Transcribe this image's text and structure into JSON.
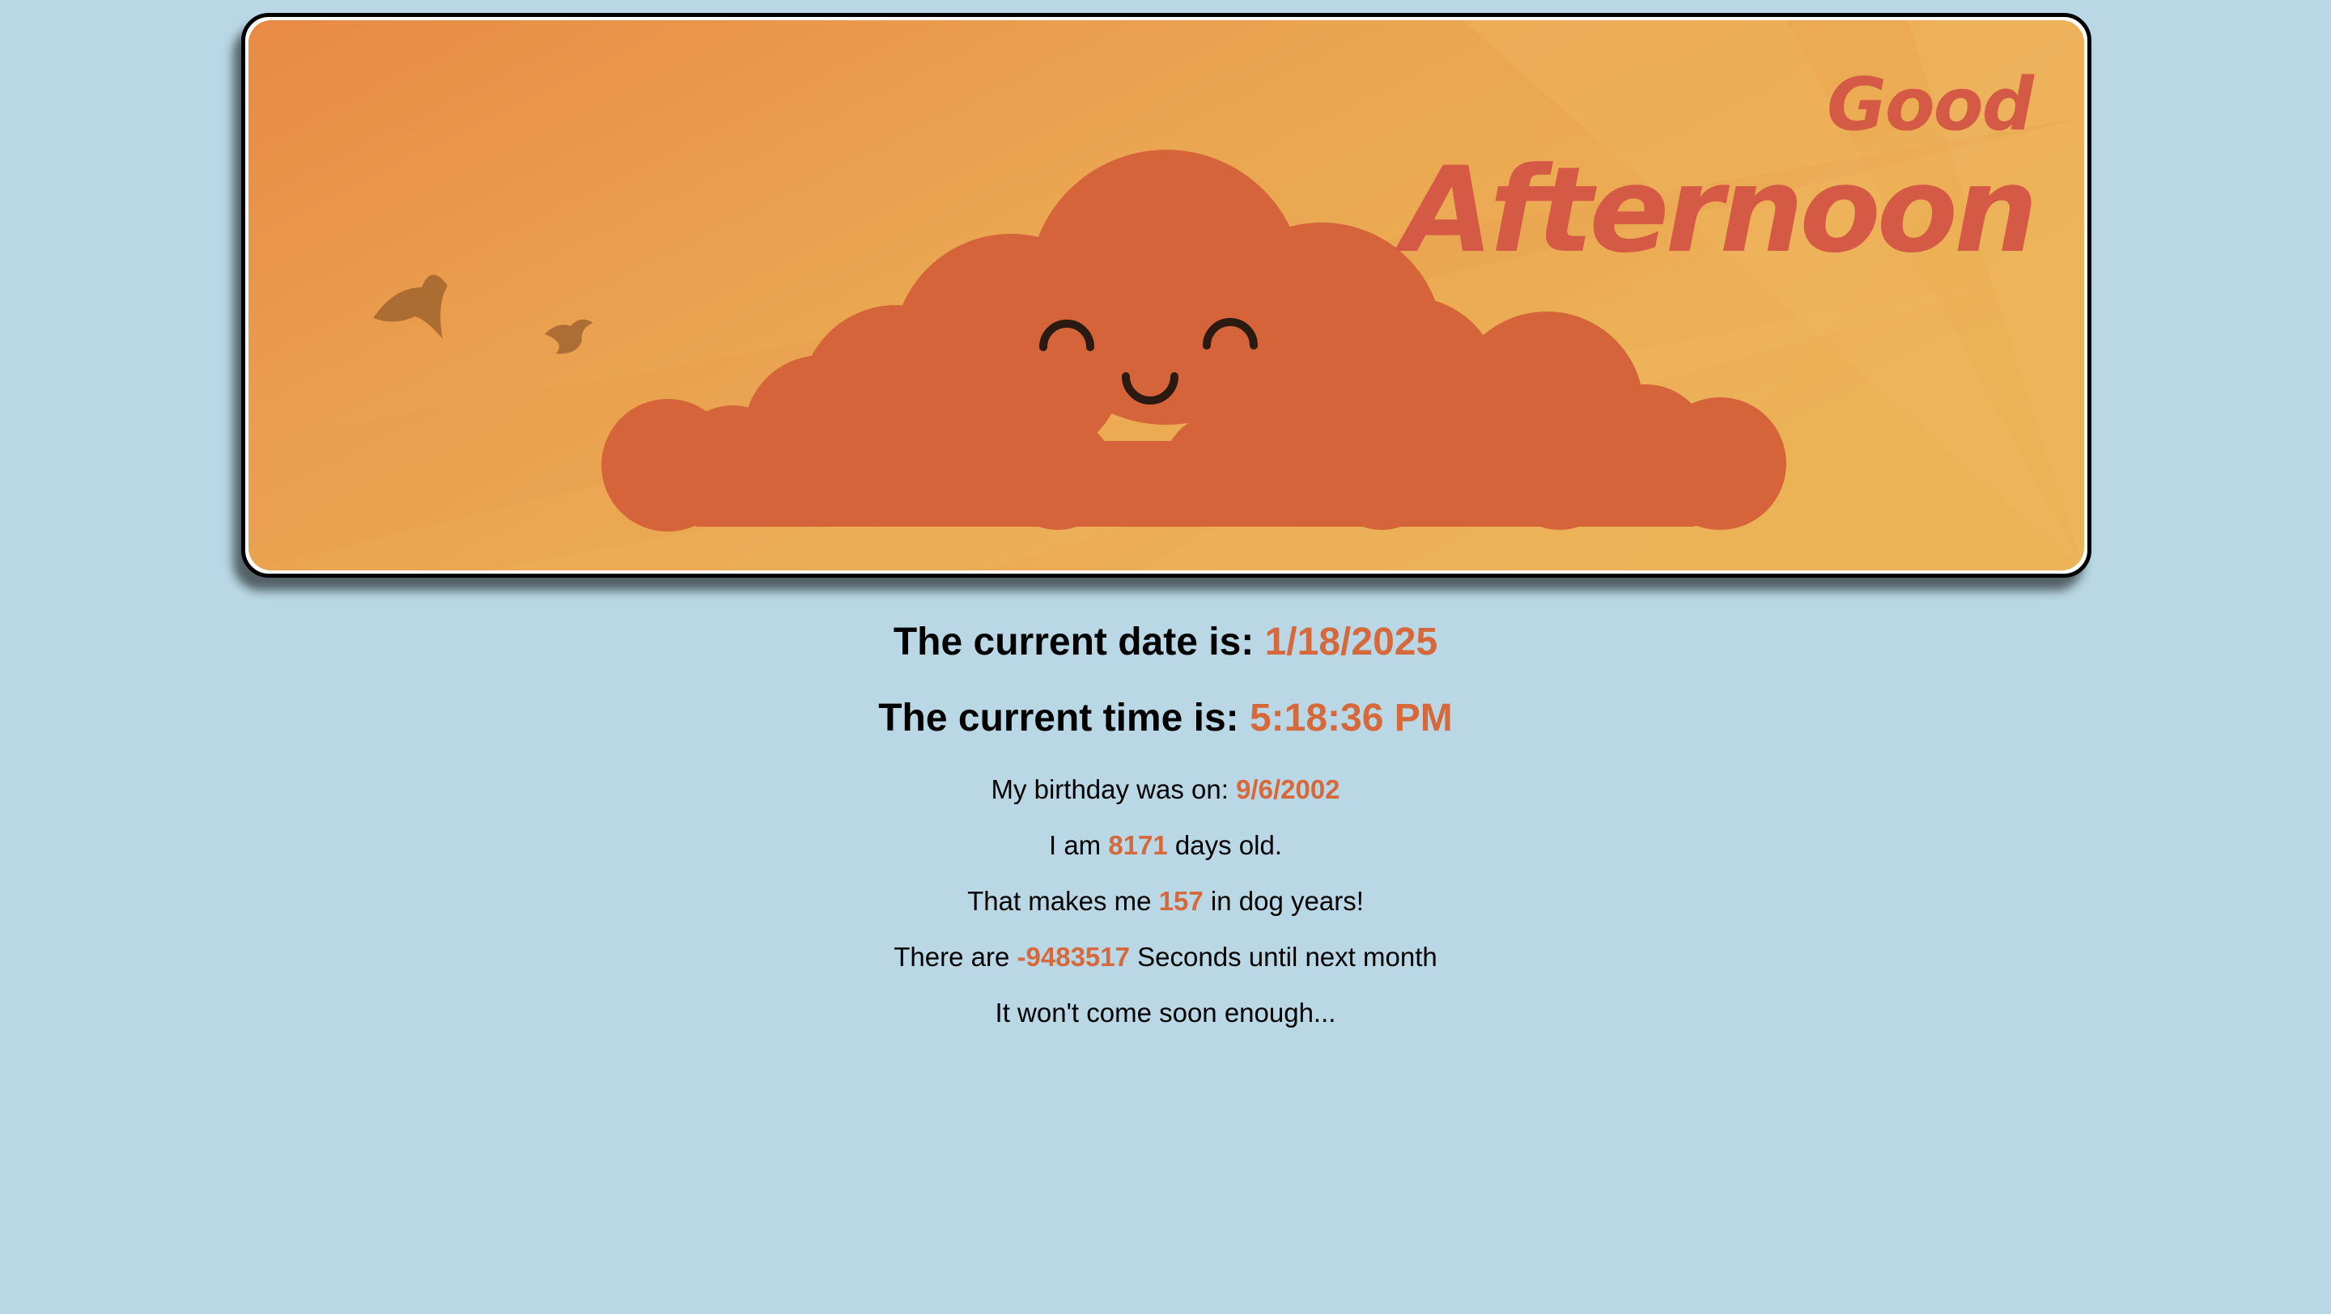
{
  "banner": {
    "greeting_line1": "Good",
    "greeting_line2": "Afternoon"
  },
  "date_line": {
    "label": "The current date is: ",
    "value": "1/18/2025"
  },
  "time_line": {
    "label": "The current time is: ",
    "value": "5:18:36 PM"
  },
  "birthday_line": {
    "label": "My birthday was on: ",
    "value": "9/6/2002"
  },
  "age_line": {
    "prefix": "I am ",
    "value": "8171",
    "suffix": " days old."
  },
  "dog_line": {
    "prefix": "That makes me ",
    "value": "157",
    "suffix": " in dog years!"
  },
  "seconds_line": {
    "prefix": "There are ",
    "value": "-9483517",
    "suffix": " Seconds until next month"
  },
  "closing_line": "It won't come soon enough...",
  "colors": {
    "background": "#b9d7e4",
    "accent": "#d6693b",
    "cloud": "#d6643a",
    "banner_orange": "#eba14d"
  }
}
